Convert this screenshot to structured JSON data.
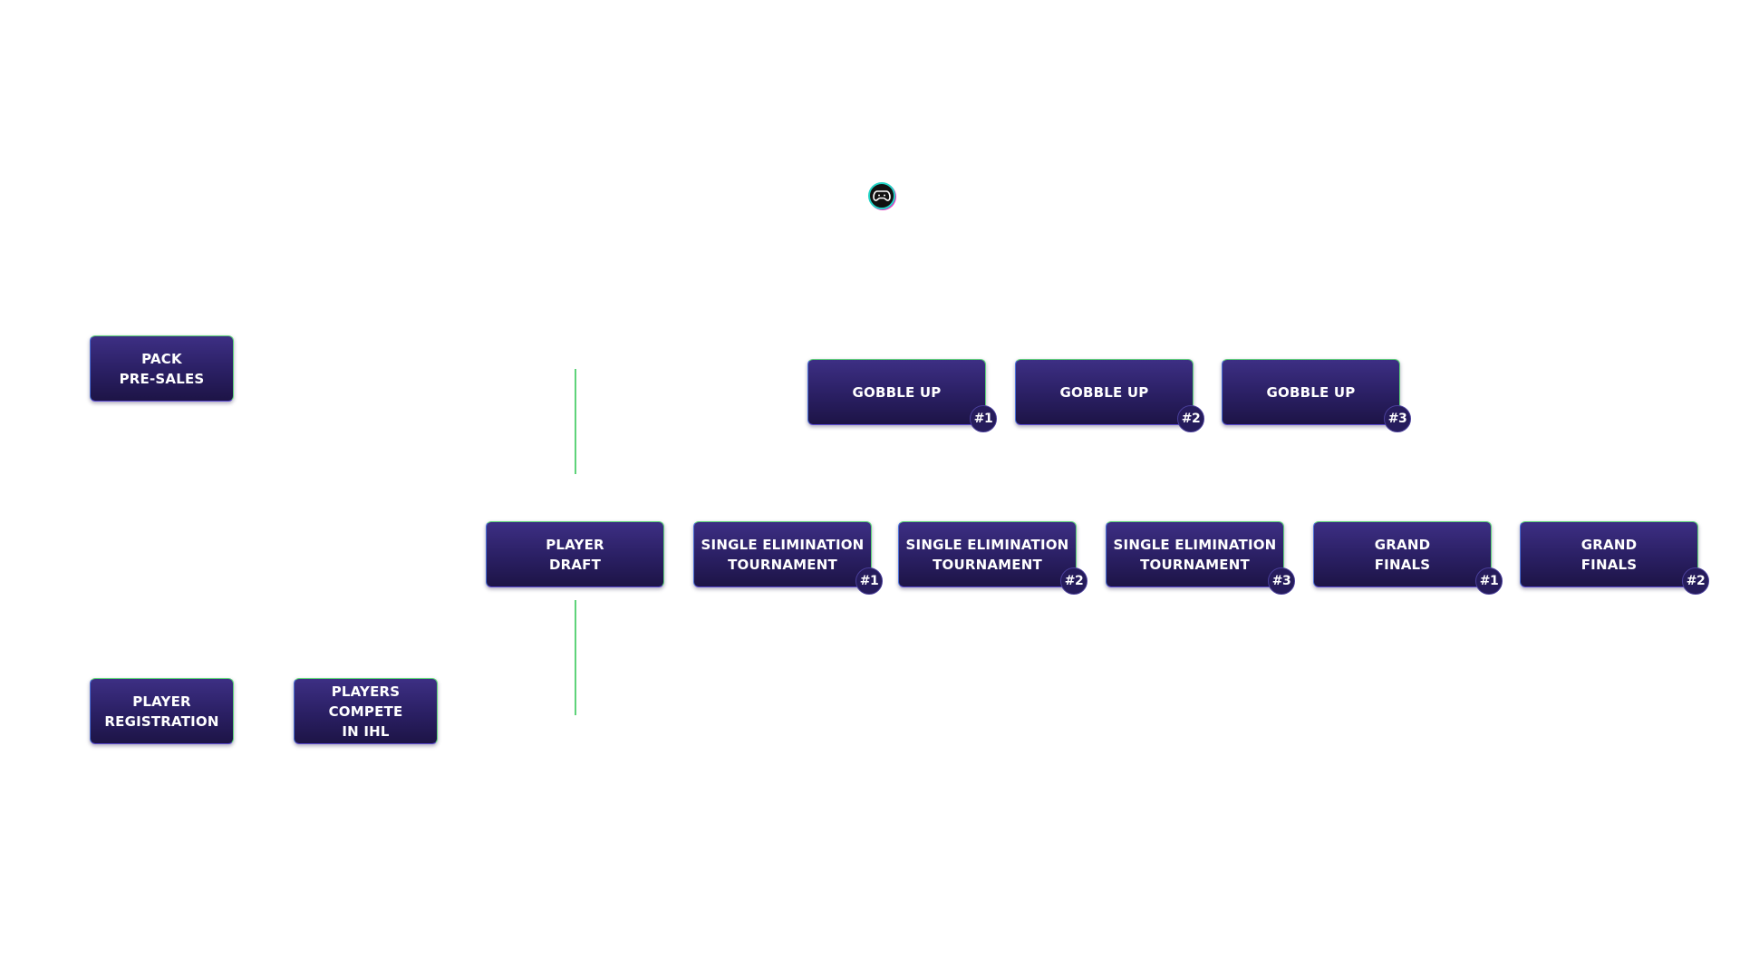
{
  "nodes": {
    "pack_pre_sales": "PACK\nPRE-SALES",
    "player_registration": "PLAYER\nREGISTRATION",
    "players_compete": "PLAYERS COMPETE\nIN IHL",
    "player_draft": "PLAYER\nDRAFT",
    "single_elim_1": "SINGLE ELIMINATION\nTOURNAMENT",
    "single_elim_2": "SINGLE ELIMINATION\nTOURNAMENT",
    "single_elim_3": "SINGLE ELIMINATION\nTOURNAMENT",
    "grand_finals_1": "GRAND\nFINALS",
    "grand_finals_2": "GRAND\nFINALS",
    "gobble_up_1": "GOBBLE UP",
    "gobble_up_2": "GOBBLE UP",
    "gobble_up_3": "GOBBLE UP"
  },
  "badges": {
    "single_elim_1": "#1",
    "single_elim_2": "#2",
    "single_elim_3": "#3",
    "grand_finals_1": "#1",
    "grand_finals_2": "#2",
    "gobble_up_1": "#1",
    "gobble_up_2": "#2",
    "gobble_up_3": "#3"
  },
  "logo": {
    "icon": "game-controller-icon"
  },
  "colors": {
    "node_top": "#3d2f84",
    "node_bottom": "#1d1446",
    "connector_green": "#5fd37a",
    "connector_blue": "#4a6fd8",
    "connector_purple": "#a46ad8",
    "badge_fill": "#261c5c",
    "logo_ring": "#22d3c5"
  }
}
